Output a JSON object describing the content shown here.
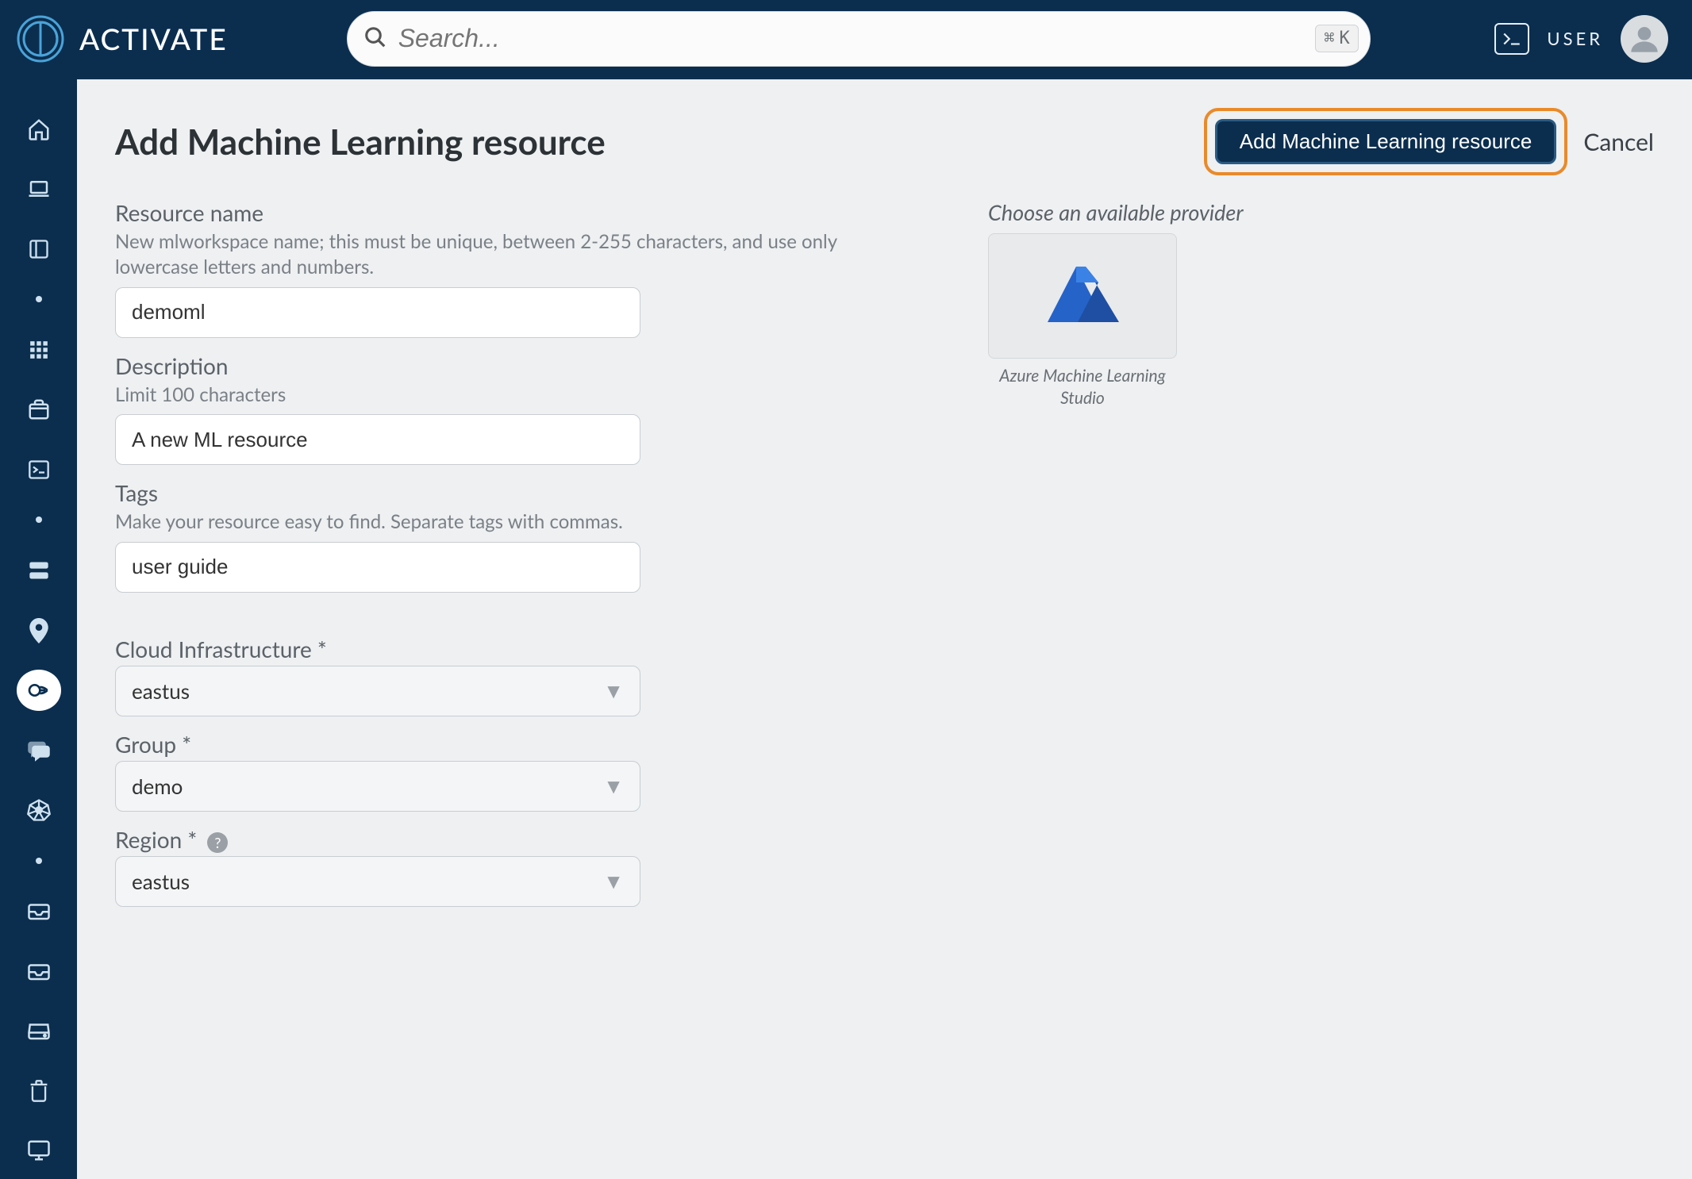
{
  "brand": {
    "name": "ACTIVATE"
  },
  "search": {
    "placeholder": "Search...",
    "kbd_mod": "⌘",
    "kbd_key": "K"
  },
  "user": {
    "label": "USER"
  },
  "page": {
    "title": "Add Machine Learning resource",
    "submit_label": "Add Machine Learning resource",
    "cancel_label": "Cancel"
  },
  "form": {
    "resource_name": {
      "label": "Resource name",
      "hint": "New mlworkspace name; this must be unique, between 2-255 characters, and use only lowercase letters and numbers.",
      "value": "demoml"
    },
    "description": {
      "label": "Description",
      "hint": "Limit 100 characters",
      "value": "A new ML resource"
    },
    "tags": {
      "label": "Tags",
      "hint": "Make your resource easy to find. Separate tags with commas.",
      "value": "user guide"
    },
    "cloud_infra": {
      "label": "Cloud Infrastructure *",
      "value": "eastus"
    },
    "group": {
      "label": "Group *",
      "value": "demo"
    },
    "region": {
      "label": "Region *",
      "value": "eastus"
    }
  },
  "provider": {
    "heading": "Choose an available provider",
    "name": "Azure Machine Learning Studio"
  }
}
